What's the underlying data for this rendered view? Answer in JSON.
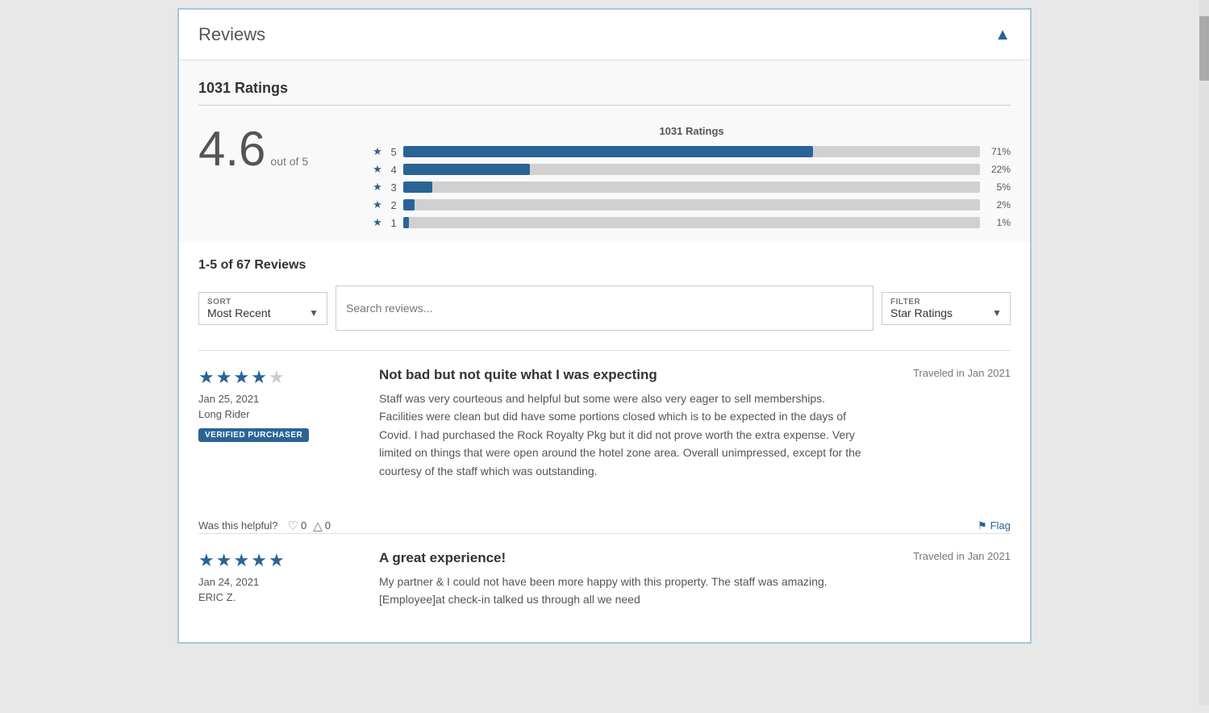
{
  "page": {
    "background": "#e8e8e8"
  },
  "reviews_panel": {
    "title": "Reviews",
    "chevron": "▲"
  },
  "ratings": {
    "total_label": "1031 Ratings",
    "chart_title": "1031 Ratings",
    "score": "4.6",
    "out_of": "out of 5",
    "bars": [
      {
        "star": "5",
        "pct": 71,
        "label": "71%"
      },
      {
        "star": "4",
        "pct": 22,
        "label": "22%"
      },
      {
        "star": "3",
        "pct": 5,
        "label": "5%"
      },
      {
        "star": "2",
        "pct": 2,
        "label": "2%"
      },
      {
        "star": "1",
        "pct": 1,
        "label": "1%"
      }
    ]
  },
  "reviews_list": {
    "count_label": "1-5 of 67 Reviews",
    "sort": {
      "label": "SORT",
      "value": "Most Recent"
    },
    "search": {
      "placeholder": "Search reviews..."
    },
    "filter": {
      "label": "FILTER",
      "value": "Star Ratings"
    }
  },
  "reviews": [
    {
      "stars": 4,
      "date": "Jan 25, 2021",
      "author": "Long Rider",
      "verified": true,
      "verified_label": "VERIFIED PURCHASER",
      "traveled": "Traveled in Jan 2021",
      "title": "Not bad but not quite what I was expecting",
      "body": "Staff was very courteous and helpful but some were also very eager to sell memberships. Facilities were clean but did have some portions closed which is to be expected in the days of Covid. I had purchased the Rock Royalty Pkg but it did not prove worth the extra expense. Very limited on things that were open around the hotel zone area. Overall unimpressed, except for the courtesy of the staff which was outstanding.",
      "helpful_label": "Was this helpful?",
      "likes": "0",
      "dislikes": "0",
      "flag_label": "Flag"
    },
    {
      "stars": 5,
      "date": "Jan 24, 2021",
      "author": "ERIC Z.",
      "verified": false,
      "verified_label": "",
      "traveled": "Traveled in Jan 2021",
      "title": "A great experience!",
      "body": "My partner & I could not have been more happy with this property. The staff was amazing. [Employee]at check-in talked us through all we need",
      "helpful_label": "",
      "likes": "",
      "dislikes": "",
      "flag_label": ""
    }
  ]
}
